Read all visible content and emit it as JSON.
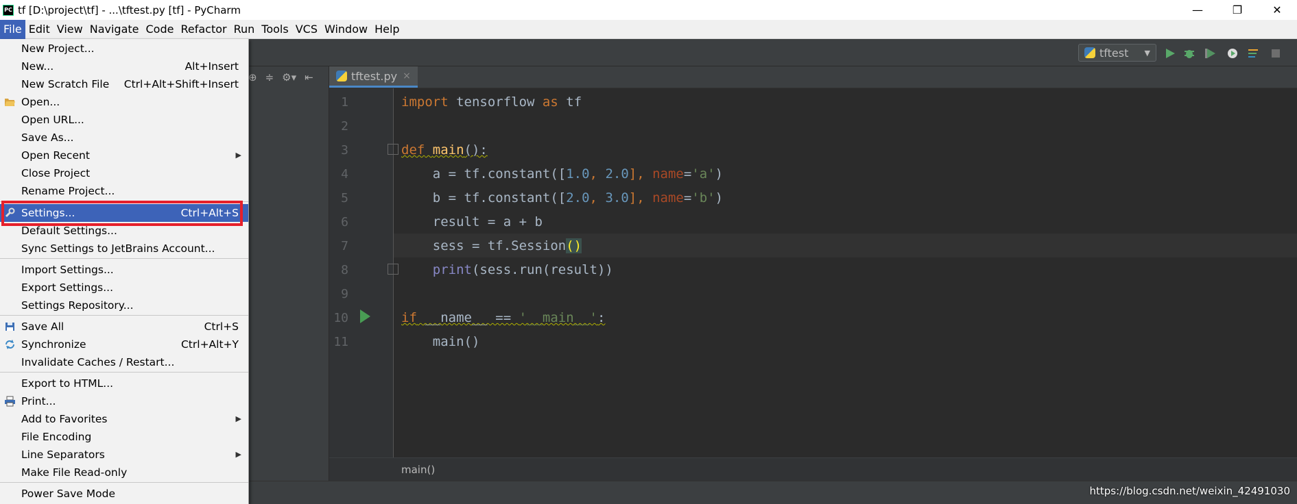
{
  "window": {
    "title": "tf [D:\\project\\tf] - ...\\tftest.py [tf] - PyCharm",
    "app_icon_text": "PC",
    "minimize": "—",
    "restore": "❐",
    "close": "✕"
  },
  "menubar": [
    "File",
    "Edit",
    "View",
    "Navigate",
    "Code",
    "Refactor",
    "Run",
    "Tools",
    "VCS",
    "Window",
    "Help"
  ],
  "toolbar": {
    "run_config": "tftest"
  },
  "editor": {
    "tab_name": "tftest.py",
    "tab_close": "×",
    "line_numbers": [
      "1",
      "2",
      "3",
      "4",
      "5",
      "6",
      "7",
      "8",
      "9",
      "10",
      "11"
    ],
    "breadcrumb": "main()"
  },
  "code": {
    "l1_import": "import",
    "l1_mod": " tensorflow ",
    "l1_as": "as",
    "l1_alias": " tf",
    "l3_def": "def",
    "l3_space": " ",
    "l3_name": "main",
    "l3_rest": "():",
    "l4_indent": "    a = tf.constant([",
    "l4_n1": "1.0",
    "l4_c1": ", ",
    "l4_n2": "2.0",
    "l4_c2": "], ",
    "l4_param": "name",
    "l4_eq": "=",
    "l4_str": "'a'",
    "l4_close": ")",
    "l5_indent": "    b = tf.constant([",
    "l5_n1": "2.0",
    "l5_c1": ", ",
    "l5_n2": "3.0",
    "l5_c2": "], ",
    "l5_param": "name",
    "l5_eq": "=",
    "l5_str": "'b'",
    "l5_close": ")",
    "l6": "    result = a + b",
    "l7_pre": "    sess = tf.Session",
    "l7_paren": "()",
    "l8_indent": "    ",
    "l8_print": "print",
    "l8_rest": "(sess.run(result))",
    "l10_if": "if",
    "l10_name": " __name__ == ",
    "l10_str": "'__main__'",
    "l10_colon": ":",
    "l11": "    main()"
  },
  "file_menu": {
    "items": [
      {
        "label": "New Project...",
        "shortcut": ""
      },
      {
        "label": "New...",
        "shortcut": "Alt+Insert"
      },
      {
        "label": "New Scratch File",
        "shortcut": "Ctrl+Alt+Shift+Insert"
      },
      {
        "label": "Open...",
        "shortcut": ""
      },
      {
        "label": "Open URL...",
        "shortcut": ""
      },
      {
        "label": "Save As...",
        "shortcut": ""
      },
      {
        "label": "Open Recent",
        "shortcut": ""
      },
      {
        "label": "Close Project",
        "shortcut": ""
      },
      {
        "label": "Rename Project...",
        "shortcut": ""
      },
      {
        "label": "Settings...",
        "shortcut": "Ctrl+Alt+S"
      },
      {
        "label": "Default Settings...",
        "shortcut": ""
      },
      {
        "label": "Sync Settings to JetBrains Account...",
        "shortcut": ""
      },
      {
        "label": "Import Settings...",
        "shortcut": ""
      },
      {
        "label": "Export Settings...",
        "shortcut": ""
      },
      {
        "label": "Settings Repository...",
        "shortcut": ""
      },
      {
        "label": "Save All",
        "shortcut": "Ctrl+S"
      },
      {
        "label": "Synchronize",
        "shortcut": "Ctrl+Alt+Y"
      },
      {
        "label": "Invalidate Caches / Restart...",
        "shortcut": ""
      },
      {
        "label": "Export to HTML...",
        "shortcut": ""
      },
      {
        "label": "Print...",
        "shortcut": ""
      },
      {
        "label": "Add to Favorites",
        "shortcut": ""
      },
      {
        "label": "File Encoding",
        "shortcut": ""
      },
      {
        "label": "Line Separators",
        "shortcut": ""
      },
      {
        "label": "Make File Read-only",
        "shortcut": ""
      },
      {
        "label": "Power Save Mode",
        "shortcut": ""
      }
    ],
    "submenu_arrow": "▶"
  },
  "watermark": "https://blog.csdn.net/weixin_42491030",
  "colors": {
    "menu_selected": "#3d63b8",
    "highlight_box": "#e6202b",
    "editor_bg": "#2b2b2b",
    "keyword": "#cc7832"
  }
}
